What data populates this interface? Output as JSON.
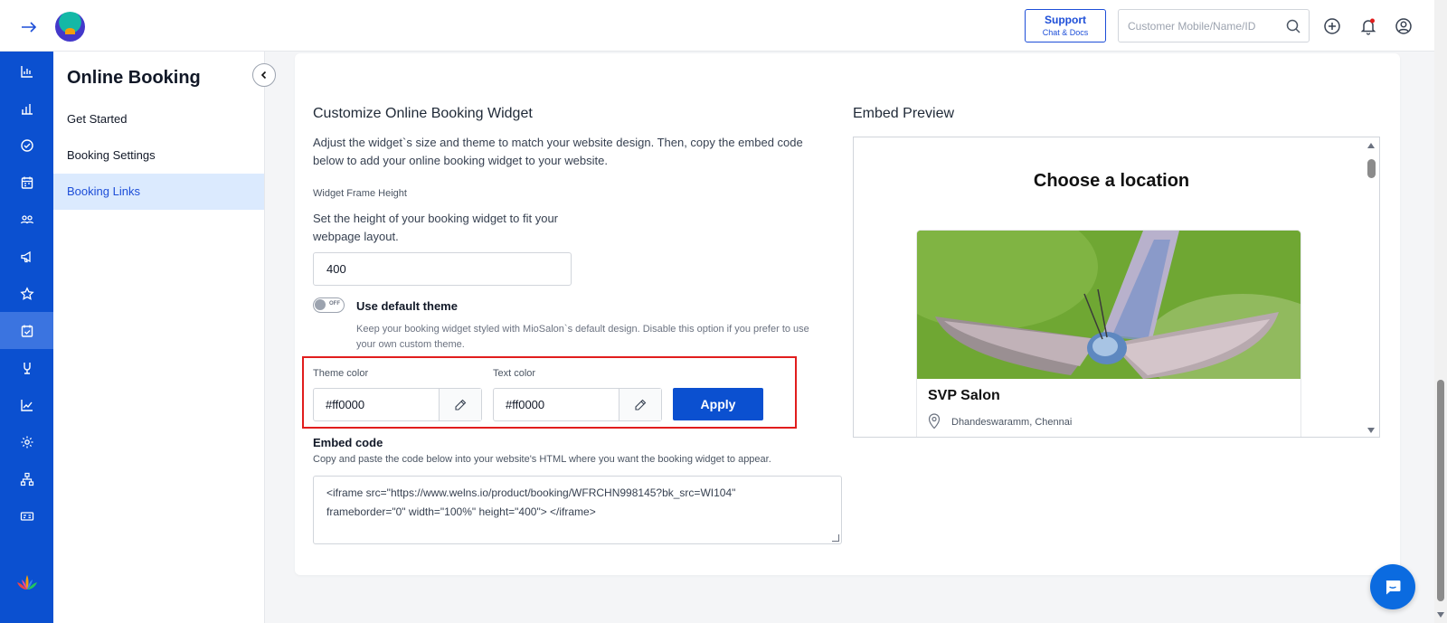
{
  "header": {
    "support_title": "Support",
    "support_subtitle": "Chat & Docs",
    "search_placeholder": "Customer Mobile/Name/ID",
    "icons": [
      "expand-arrow-icon",
      "app-logo",
      "search-icon",
      "add-circle-icon",
      "notification-bell-icon",
      "user-account-icon"
    ],
    "notification_dot_color": "#e11d1d"
  },
  "rail": {
    "items": [
      "dashboard-icon",
      "analytics-icon",
      "tasks-icon",
      "calendar-icon",
      "customers-icon",
      "marketing-icon",
      "favorites-icon",
      "online-booking-icon",
      "wellness-icon",
      "reports-icon",
      "settings-icon",
      "organization-icon",
      "billing-icon"
    ],
    "active_index": 7,
    "accent": "#0b50d0"
  },
  "sidemenu": {
    "title": "Online Booking",
    "items": [
      {
        "label": "Get Started"
      },
      {
        "label": "Booking Settings"
      },
      {
        "label": "Booking Links",
        "active": true
      }
    ]
  },
  "widget": {
    "title": "Customize Online Booking Widget",
    "description_line1": "Adjust the widget`s size and theme to match your website design. Then, copy the embed code",
    "description_line2": "below to add your online booking widget to your website.",
    "frame_height_label": "Widget Frame Height",
    "frame_height_help_line1": "Set the height of your booking widget to fit your",
    "frame_height_help_line2": "webpage layout.",
    "frame_height_value": "400",
    "toggle_state": "OFF",
    "default_theme_label": "Use default theme",
    "default_theme_help_line1": "Keep your booking widget styled with MioSalon`s default design. Disable this option if you prefer to use",
    "default_theme_help_line2": "your own custom theme.",
    "theme_color_label": "Theme color",
    "theme_color_value": "#ff0000",
    "text_color_label": "Text color",
    "text_color_value": "#ff0000",
    "apply_label": "Apply",
    "embed_title": "Embed code",
    "embed_help": "Copy and paste the code below into your website's HTML where you want the booking widget to appear.",
    "embed_line1": "<iframe src=\"https://www.welns.io/product/booking/WFRCHN998145?bk_src=WI104\"",
    "embed_line2": "frameborder=\"0\" width=\"100%\" height=\"400\"> </iframe>",
    "highlight_color": "#e11d1d"
  },
  "preview": {
    "title": "Embed Preview",
    "heading": "Choose a location",
    "salon_name": "SVP Salon",
    "salon_address": "Dhandeswaramm, Chennai"
  }
}
